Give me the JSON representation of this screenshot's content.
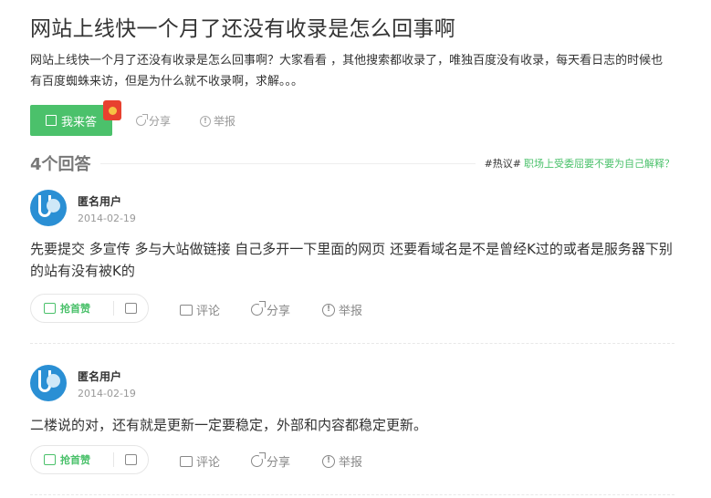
{
  "question": {
    "title": "网站上线快一个月了还没有收录是怎么回事啊",
    "description": "网站上线快一个月了还没有收录是怎么回事啊？大家看看 ，其他搜索都收录了，唯独百度没有收录，每天看日志的时候也有百度蜘蛛来访，但是为什么就不收录啊，求解。。。",
    "answer_button": "我来答",
    "share_label": "分享",
    "report_label": "举报"
  },
  "answers_header": {
    "count_label": "4个回答",
    "hot_tag": "#热议#",
    "hot_link": "职场上受委屈要不要为自己解释？"
  },
  "answers": [
    {
      "user": "匿名用户",
      "date": "2014-02-19",
      "text": "先要提交 多宣传 多与大站做链接 自己多开一下里面的网页 还要看域名是不是曾经K过的或者是服务器下别的站有没有被K的",
      "vote_label": "抢首赞",
      "comment_label": "评论",
      "share_label": "分享",
      "report_label": "举报"
    },
    {
      "user": "匿名用户",
      "date": "2014-02-19",
      "text": "二楼说的对，还有就是更新一定要稳定，外部和内容都稳定更新。",
      "vote_label": "抢首赞",
      "comment_label": "评论",
      "share_label": "分享",
      "report_label": "举报"
    }
  ],
  "colors": {
    "accent_green": "#4bc16b",
    "avatar_blue": "#2a8fd4",
    "red_packet": "#e8412f"
  },
  "icons": [
    "edit-icon",
    "red-packet-icon",
    "share-icon",
    "report-icon",
    "thumb-up-icon",
    "thumb-down-icon",
    "comment-icon",
    "avatar"
  ]
}
